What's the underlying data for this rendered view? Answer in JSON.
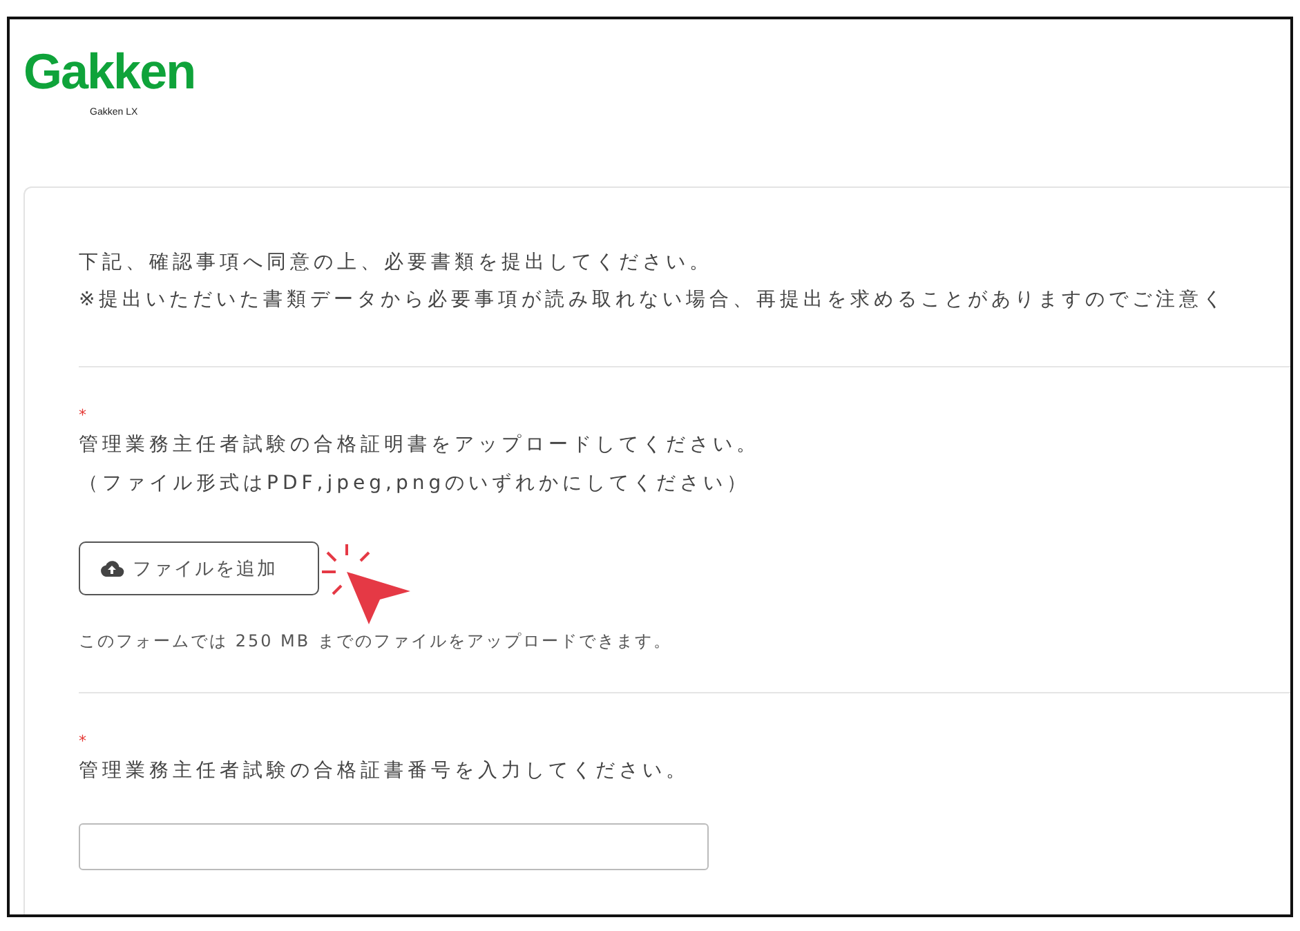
{
  "header": {
    "logo": "Gakken",
    "logo_subtitle": "Gakken LX"
  },
  "intro": [
    "下記、確認事項へ同意の上、必要書類を提出してください。",
    "※提出いただいた書類データから必要事項が読み取れない場合、再提出を求めることがありますのでご注意く"
  ],
  "questions": [
    {
      "kind": "upload",
      "required_mark": "*",
      "lines": [
        "管理業務主任者試験の合格証明書をアップロードしてください。",
        "（ファイル形式はPDF,jpeg,pngのいずれかにしてください）"
      ],
      "button": "ファイルを追加",
      "note": "このフォームでは 250 MB までのファイルをアップロードできます。"
    },
    {
      "kind": "text",
      "required_mark": "*",
      "lines": [
        "管理業務主任者試験の合格証書番号を入力してください。"
      ]
    }
  ]
}
